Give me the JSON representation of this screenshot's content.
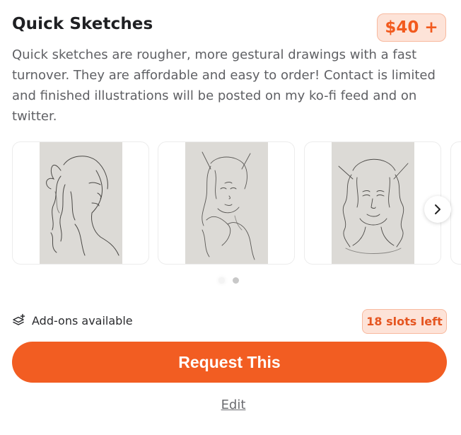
{
  "header": {
    "title": "Quick Sketches",
    "price": "$40 +"
  },
  "description": "Quick sketches are rougher, more gestural drawings with a fast turnover. They are affordable and easy to order! Contact is limited and finished illustrations will be posted on my ko-fi feed and on twitter.",
  "carousel": {
    "images": [
      {
        "icon": "sketch-horned-woman-image"
      },
      {
        "icon": "sketch-elf-woman-image"
      },
      {
        "icon": "sketch-curly-hair-woman-image"
      }
    ],
    "next_icon": "chevron-right-icon",
    "page_count": 2,
    "active_page": 1
  },
  "addons": {
    "icon": "layers-plus-icon",
    "label": "Add-ons available"
  },
  "slots": "18 slots left",
  "request_button": "Request This",
  "edit_link": "Edit",
  "colors": {
    "accent": "#f25d22",
    "accent_soft": "#fde3d8",
    "sketch_bg": "#dcdad6"
  }
}
